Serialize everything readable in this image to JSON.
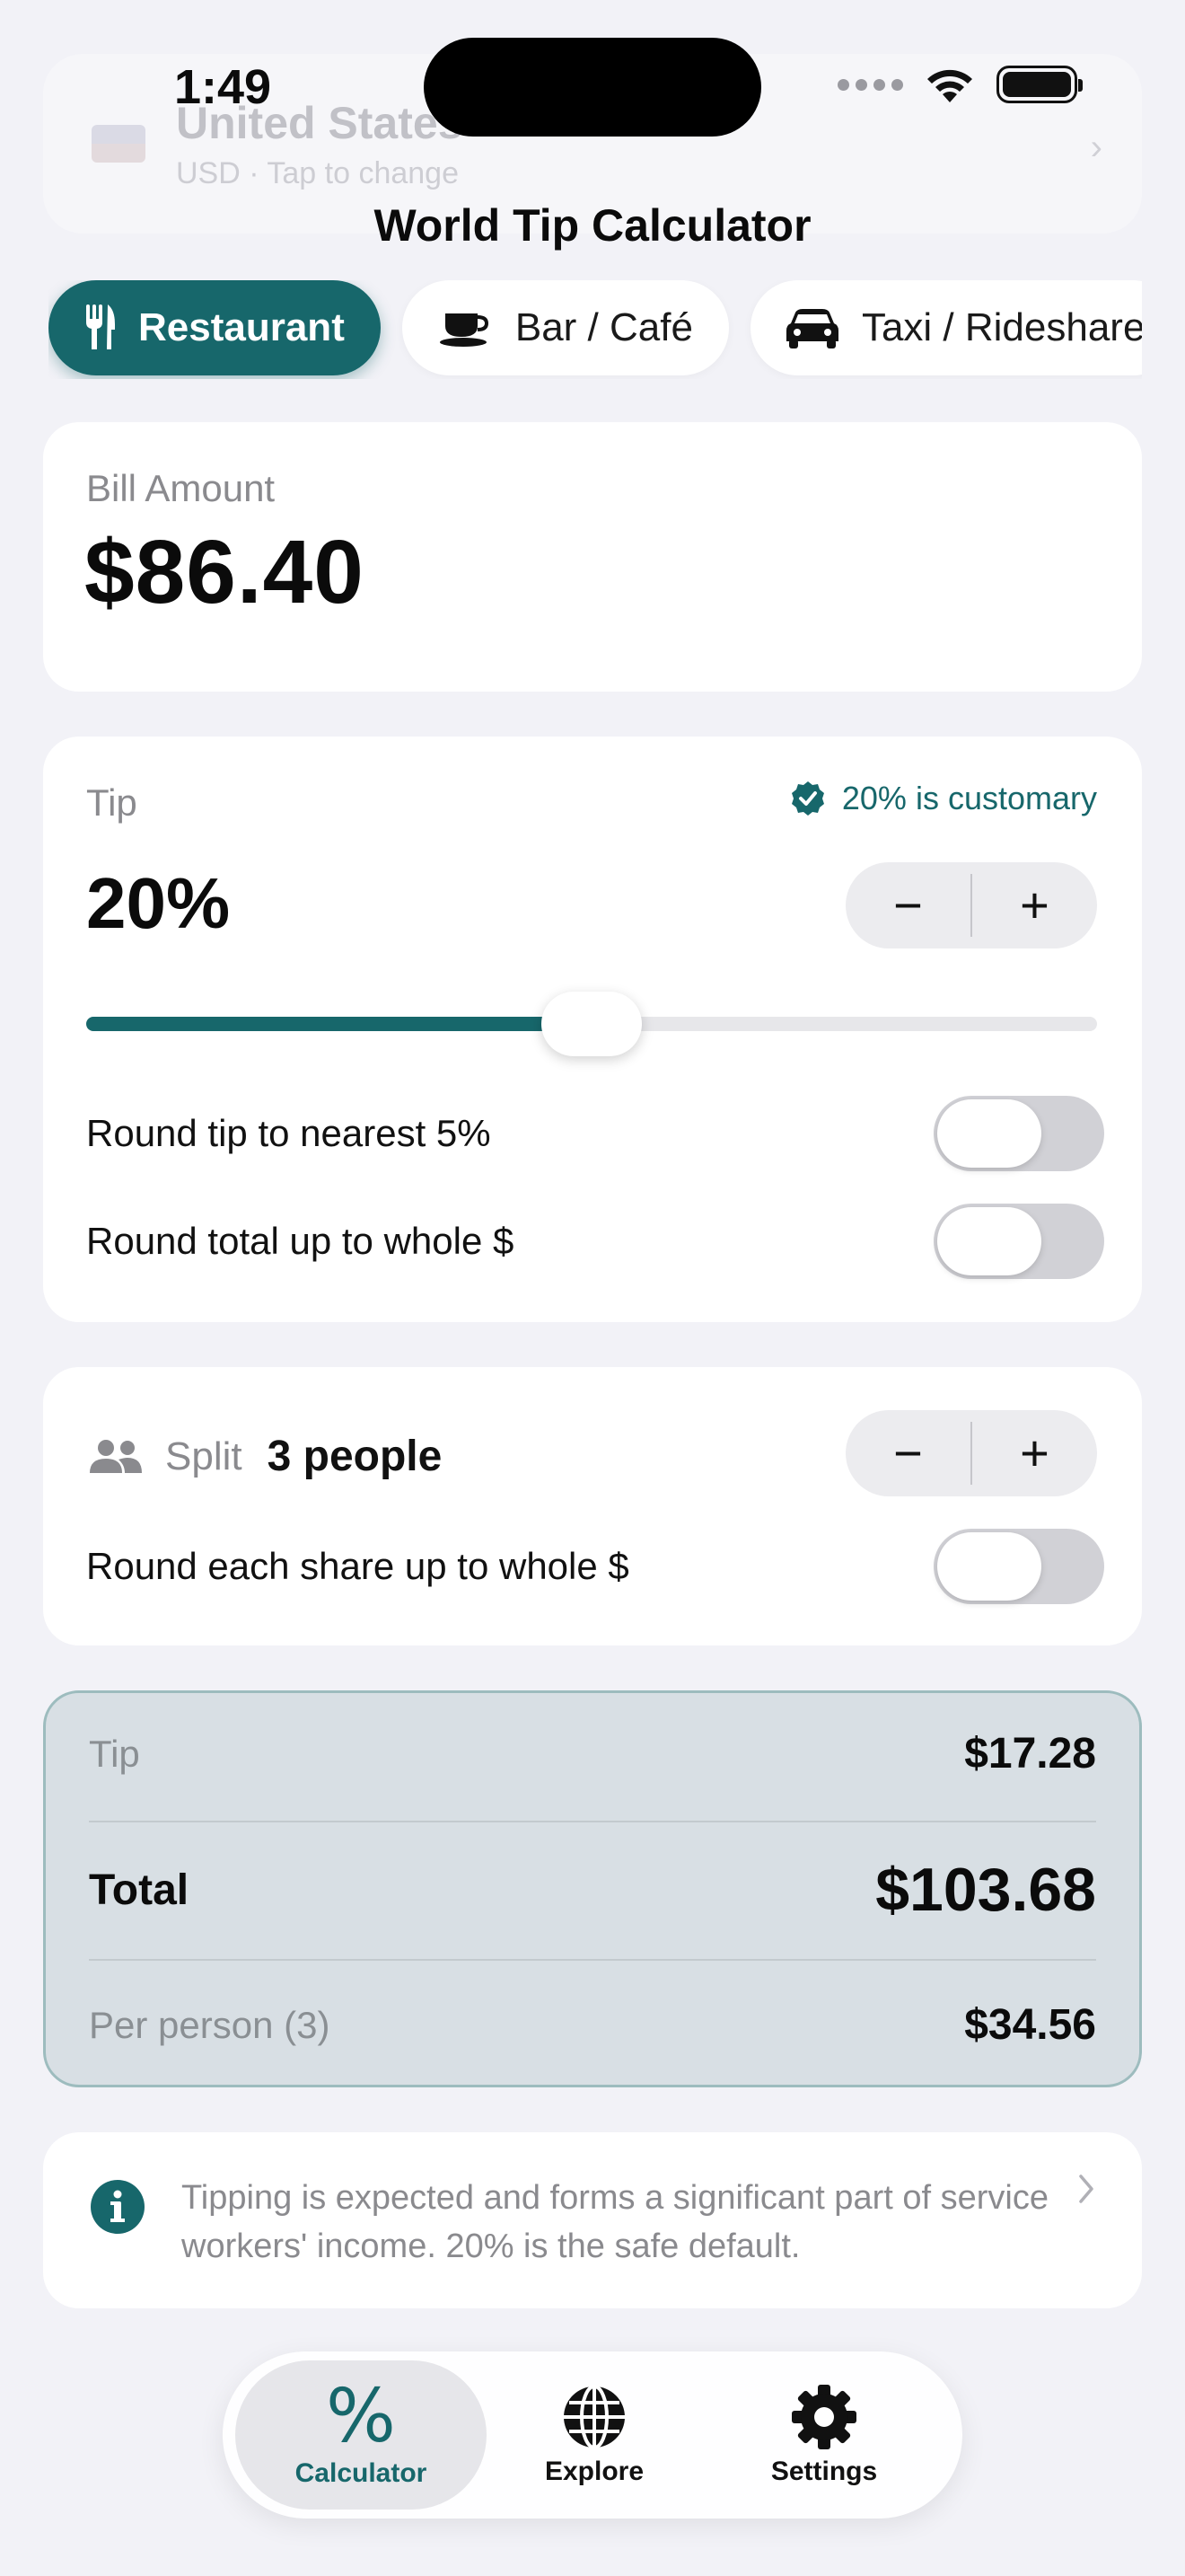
{
  "status_bar": {
    "time": "1:49"
  },
  "background_header": {
    "country": "United States",
    "subtitle": "USD · Tap to change"
  },
  "app": {
    "title": "World Tip Calculator"
  },
  "categories": [
    {
      "label": "Restaurant",
      "icon": "fork-knife-icon",
      "active": true
    },
    {
      "label": "Bar / Café",
      "icon": "coffee-cup-icon",
      "active": false
    },
    {
      "label": "Taxi / Rideshare",
      "icon": "car-icon",
      "active": false
    }
  ],
  "bill": {
    "label": "Bill Amount",
    "value": "$86.40"
  },
  "tip": {
    "label": "Tip",
    "customary_badge": "20% is customary",
    "value": "20%",
    "slider_fraction": 0.5,
    "stepper_minus": "−",
    "stepper_plus": "+",
    "round_tip_label": "Round tip to nearest 5%",
    "round_tip_on": false,
    "round_total_label": "Round total up to whole $",
    "round_total_on": false
  },
  "split": {
    "label": "Split",
    "count_text": "3 people",
    "stepper_minus": "−",
    "stepper_plus": "+",
    "round_share_label": "Round each share up to whole $",
    "round_share_on": false
  },
  "summary": {
    "tip_label": "Tip",
    "tip_value": "$17.28",
    "total_label": "Total",
    "total_value": "$103.68",
    "per_person_label": "Per person (3)",
    "per_person_value": "$34.56"
  },
  "info": {
    "text": "Tipping is expected and forms a significant part of service workers' income. 20% is the safe default."
  },
  "tabbar": {
    "items": [
      {
        "label": "Calculator",
        "icon": "percent-icon",
        "active": true
      },
      {
        "label": "Explore",
        "icon": "globe-icon",
        "active": false
      },
      {
        "label": "Settings",
        "icon": "gear-icon",
        "active": false
      }
    ]
  },
  "colors": {
    "accent": "#17676b",
    "background": "#f2f2f7",
    "card": "#ffffff",
    "summary_bg": "#d8dfe4",
    "summary_border": "#9dbcbe"
  }
}
